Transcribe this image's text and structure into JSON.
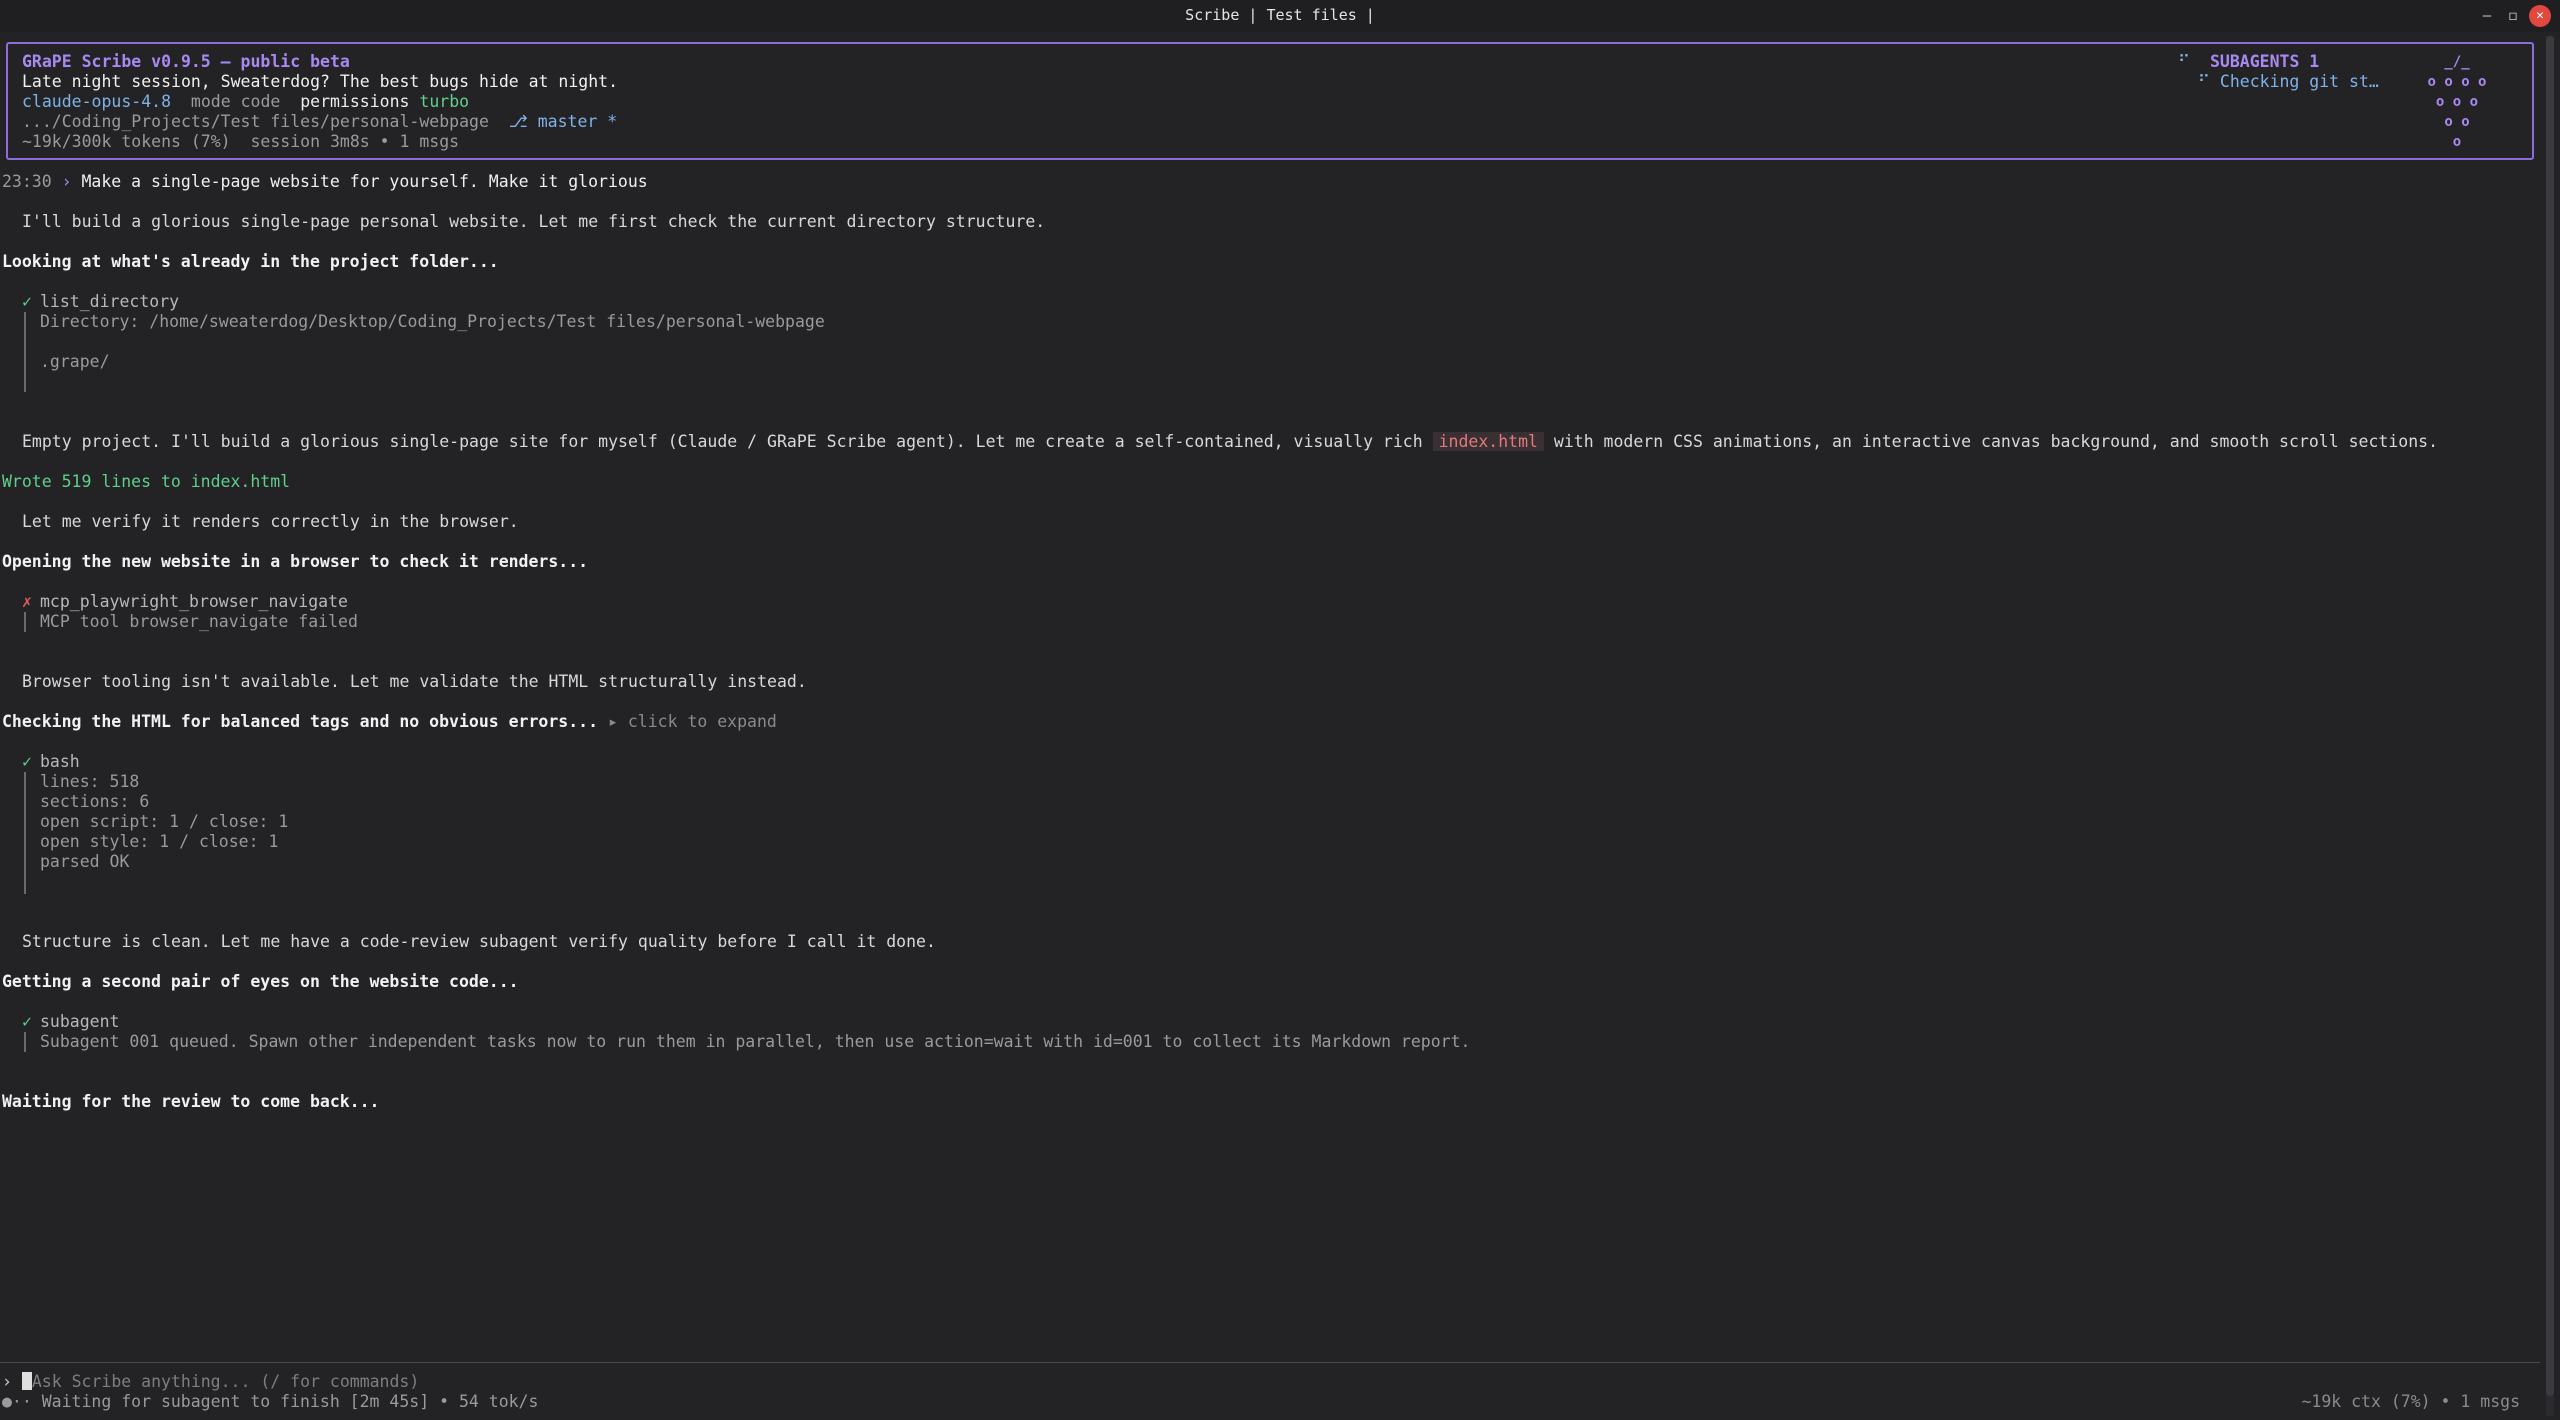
{
  "window": {
    "title": "Scribe | Test files |",
    "controls": {
      "minimize": "–",
      "maximize": "◻",
      "close": "✕"
    }
  },
  "header": {
    "app_version": "GRaPE Scribe v0.9.5 – public beta",
    "greeting": "Late night session, Sweaterdog? The best bugs hide at night.",
    "model": "claude-opus-4.8",
    "mode_label": "mode",
    "mode_value": "code",
    "permissions_label": "permissions",
    "permissions_value": "turbo",
    "path": ".../Coding_Projects/Test files/personal-webpage",
    "branch": "⎇ master *",
    "tokens": "~19k/300k tokens (7%)",
    "session": "session 3m8s • 1 msgs",
    "subagents_title": "SUBAGENTS 1",
    "subagent_marker": "⠋",
    "subagent_item": "⠋ Checking git st…",
    "logo_lines": [
      "_/_",
      "o o o o",
      "o o o",
      "o o",
      "o"
    ]
  },
  "transcript": {
    "user_time": "23:30",
    "user_chevron": "›",
    "user_message": "Make a single-page website for yourself. Make it glorious",
    "msg1": "I'll build a glorious single-page personal website. Let me first check the current directory structure.",
    "step1": "Looking at what's already in the project folder...",
    "tool1": {
      "status": "✓",
      "name": "list_directory",
      "lines": [
        "Directory: /home/sweaterdog/Desktop/Coding_Projects/Test files/personal-webpage",
        "",
        ".grape/"
      ]
    },
    "msg2_pre": "Empty project. I'll build a glorious single-page site for myself (Claude / GRaPE Scribe agent). Let me create a self-contained, visually rich",
    "msg2_code": "index.html",
    "msg2_post": "with modern CSS animations, an interactive canvas background, and smooth scroll sections.",
    "wrote": "Wrote 519 lines to index.html",
    "msg3": "Let me verify it renders correctly in the browser.",
    "step2": "Opening the new website in a browser to check it renders...",
    "tool2": {
      "status": "✗",
      "name": "mcp_playwright_browser_navigate",
      "lines": [
        "MCP tool browser_navigate failed"
      ]
    },
    "msg4": "Browser tooling isn't available. Let me validate the HTML structurally instead.",
    "step3": "Checking the HTML for balanced tags and no obvious errors...",
    "step3_expand": "▸ click to expand",
    "tool3": {
      "status": "✓",
      "name": "bash",
      "lines": [
        "lines: 518",
        "sections: 6",
        "open script: 1 / close: 1",
        "open style: 1 / close: 1",
        "parsed OK"
      ]
    },
    "msg5": "Structure is clean. Let me have a code-review subagent verify quality before I call it done.",
    "step4": "Getting a second pair of eyes on the website code...",
    "tool4": {
      "status": "✓",
      "name": "subagent",
      "lines": [
        "Subagent 001 queued. Spawn other independent tasks now to run them in parallel, then use action=wait with id=001 to collect its Markdown report."
      ]
    },
    "step5": "Waiting for the review to come back..."
  },
  "input": {
    "prompt_symbol": "›",
    "placeholder": "Ask Scribe anything... (/ for commands)",
    "status": "●·· Waiting for subagent to finish [2m 45s] • 54 tok/s",
    "context": "~19k ctx (7%) • 1 msgs"
  },
  "colors": {
    "background": "#232326",
    "accent": "#8b6ddc",
    "success": "#5fcf8a",
    "error": "#e05d5d",
    "link": "#7fb2e6"
  }
}
